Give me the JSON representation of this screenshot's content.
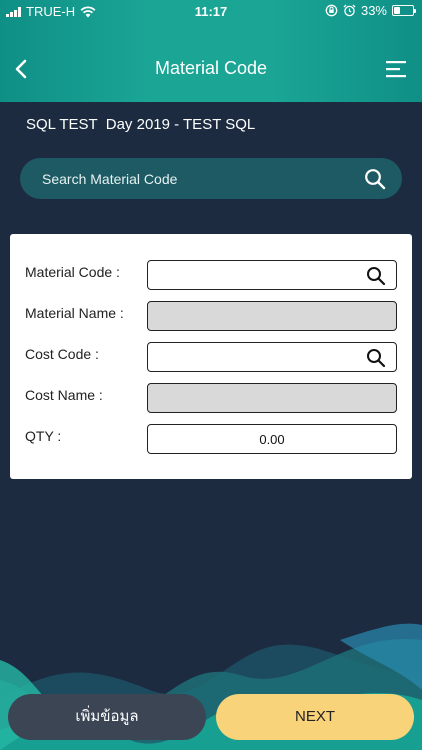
{
  "status": {
    "carrier": "TRUE-H",
    "time": "11:17",
    "battery": "33%",
    "battery_level": 0.33
  },
  "nav": {
    "title": "Material Code"
  },
  "subtitle": "SQL TEST  Day 2019 - TEST SQL",
  "search": {
    "placeholder": "Search Material Code"
  },
  "form": {
    "material_code_label": "Material Code :",
    "material_code_value": "",
    "material_name_label": "Material Name :",
    "material_name_value": "",
    "cost_code_label": "Cost Code :",
    "cost_code_value": "",
    "cost_name_label": "Cost Name :",
    "cost_name_value": "",
    "qty_label": "QTY :",
    "qty_value": "0.00"
  },
  "buttons": {
    "add_label": "เพิ่มข้อมูล",
    "next_label": "NEXT"
  },
  "colors": {
    "header": "#1aa595",
    "background": "#1c2b40",
    "next_button": "#f8d37a",
    "add_button": "#3c4554"
  }
}
